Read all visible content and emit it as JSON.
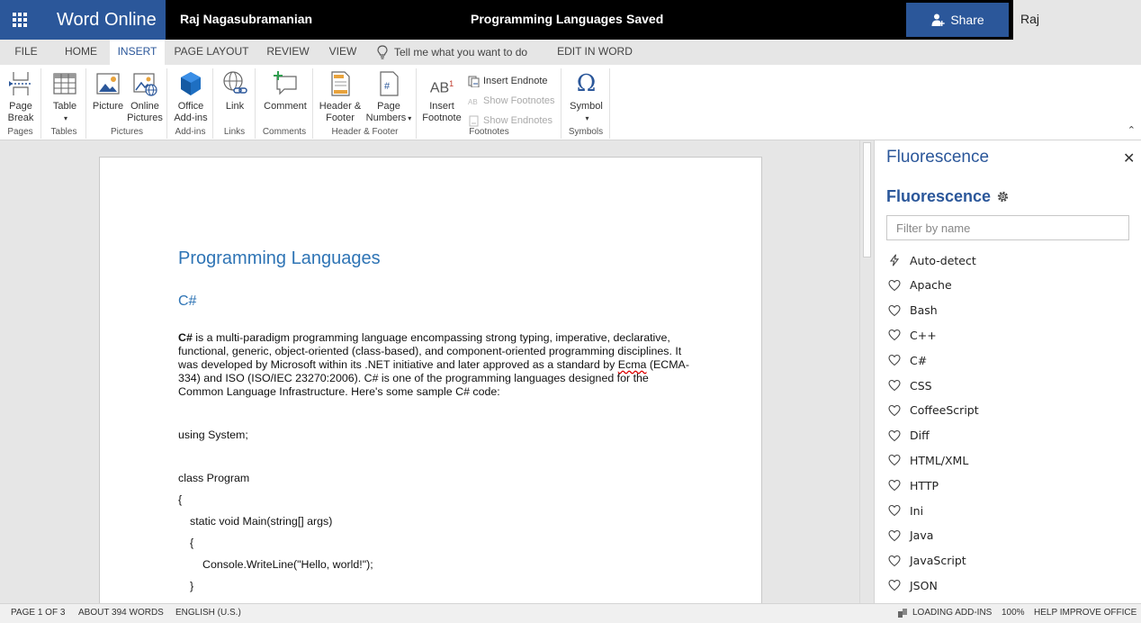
{
  "titlebar": {
    "app_name": "Word Online",
    "user_name": "Raj Nagasubramanian",
    "document_title": "Programming Languages",
    "separator": "-",
    "save_status": "Saved",
    "share_label": "Share",
    "account_name": "Raj Nagasubramanian"
  },
  "menu": {
    "tabs": [
      "FILE",
      "HOME",
      "INSERT",
      "PAGE LAYOUT",
      "REVIEW",
      "VIEW"
    ],
    "active_tab": "INSERT",
    "tell_me": "Tell me what you want to do",
    "edit_in_word": "EDIT IN WORD"
  },
  "ribbon": {
    "groups": {
      "pages": "Pages",
      "tables": "Tables",
      "pictures": "Pictures",
      "addins": "Add-ins",
      "links": "Links",
      "comments": "Comments",
      "header_footer": "Header & Footer",
      "footnotes": "Footnotes",
      "symbols": "Symbols"
    },
    "buttons": {
      "page_break_1": "Page",
      "page_break_2": "Break",
      "table": "Table",
      "picture": "Picture",
      "online_pictures_1": "Online",
      "online_pictures_2": "Pictures",
      "office_addins_1": "Office",
      "office_addins_2": "Add-ins",
      "link": "Link",
      "comment": "Comment",
      "header_footer_1": "Header &",
      "header_footer_2": "Footer",
      "page_numbers_1": "Page",
      "page_numbers_2": "Numbers",
      "insert_footnote_1": "Insert",
      "insert_footnote_2": "Footnote",
      "insert_endnote": "Insert Endnote",
      "show_footnotes": "Show Footnotes",
      "show_endnotes": "Show Endnotes",
      "symbol": "Symbol",
      "symbol_glyph": "Ω",
      "footnote_glyph": "AB"
    }
  },
  "document": {
    "heading1": "Programming Languages",
    "heading2": "C#",
    "para_bold": "C#",
    "para_part1": " is a multi-paradigm programming language encompassing strong typing, imperative, declarative, functional, generic, object-oriented (class-based), and component-oriented programming disciplines. It was developed by Microsoft within its .NET initiative and later approved as a standard by ",
    "para_ecma": "Ecma",
    "para_part2": " (ECMA-334) and ISO (ISO/IEC 23270:2006). C# is one of the programming languages designed for the Common Language Infrastructure. Here's some sample C# code:",
    "code": [
      "using System;",
      "class Program",
      "{",
      "static void Main(string[] args)",
      "{",
      "Console.WriteLine(\"Hello, world!\");",
      "}"
    ]
  },
  "pane": {
    "title": "Fluorescence",
    "heading": "Fluorescence",
    "close_glyph": "✕",
    "filter_placeholder": "Filter by name",
    "languages": [
      "Auto-detect",
      "Apache",
      "Bash",
      "C++",
      "C#",
      "CSS",
      "CoffeeScript",
      "Diff",
      "HTML/XML",
      "HTTP",
      "Ini",
      "Java",
      "JavaScript",
      "JSON"
    ]
  },
  "statusbar": {
    "page": "PAGE 1 OF 3",
    "words": "ABOUT 394 WORDS",
    "language": "ENGLISH (U.S.)",
    "loading": "LOADING ADD-INS",
    "zoom": "100%",
    "help": "HELP IMPROVE OFFICE"
  },
  "colors": {
    "brand_blue": "#2b579a",
    "heading_blue": "#2e74b5"
  }
}
